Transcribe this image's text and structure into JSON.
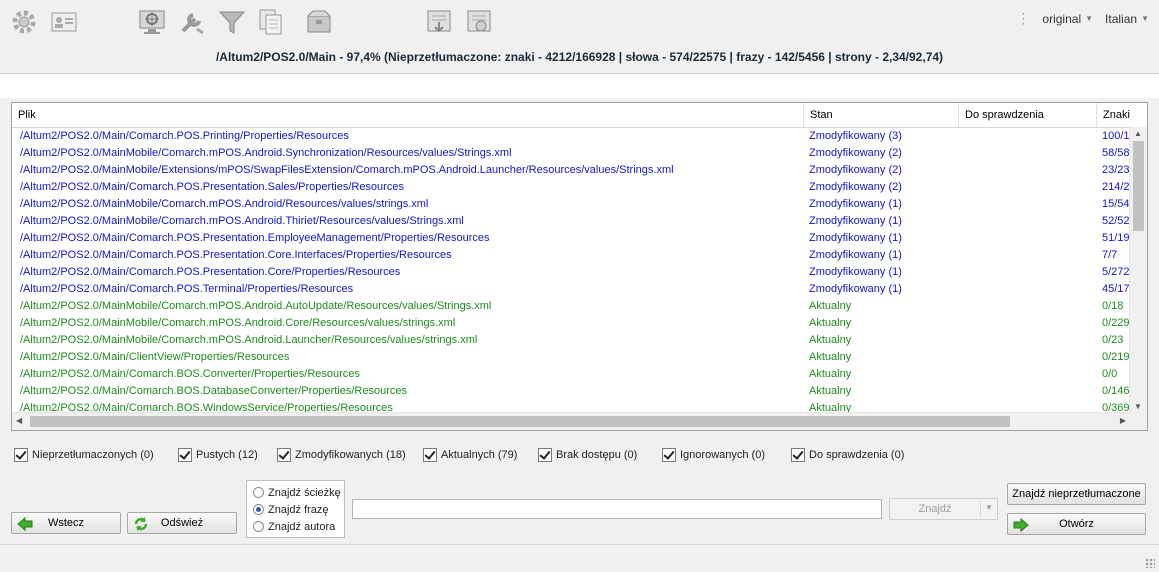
{
  "toolbar": {
    "icons": [
      "gear-icon",
      "id-card-icon",
      "monitor-target-icon",
      "tools-icon",
      "filter-icon",
      "documents-icon",
      "package-icon",
      "download-list-icon",
      "upload-list-icon"
    ],
    "version_select": "original",
    "language_select": "Italian"
  },
  "header": {
    "path_info": "/Altum2/POS2.0/Main - 97,4% (Nieprzetłumaczone: znaki - 4212/166928 | słowa - 574/22575 | frazy - 142/5456 | strony - 2,34/92,74)"
  },
  "table": {
    "columns": [
      "Plik",
      "Stan",
      "Do sprawdzenia",
      "Znaki"
    ],
    "rows": [
      {
        "file": "/Altum2/POS2.0/Main/Comarch.POS.Printing/Properties/Resources",
        "status": "Zmodyfikowany (3)",
        "check": "",
        "chars": "100/1",
        "color": "blue"
      },
      {
        "file": "/Altum2/POS2.0/MainMobile/Comarch.mPOS.Android.Synchronization/Resources/values/Strings.xml",
        "status": "Zmodyfikowany (2)",
        "check": "",
        "chars": "58/58",
        "color": "blue"
      },
      {
        "file": "/Altum2/POS2.0/MainMobile/Extensions/mPOS/SwapFilesExtension/Comarch.mPOS.Android.Launcher/Resources/values/Strings.xml",
        "status": "Zmodyfikowany (2)",
        "check": "",
        "chars": "23/23",
        "color": "blue"
      },
      {
        "file": "/Altum2/POS2.0/Main/Comarch.POS.Presentation.Sales/Properties/Resources",
        "status": "Zmodyfikowany (2)",
        "check": "",
        "chars": "214/2",
        "color": "blue"
      },
      {
        "file": "/Altum2/POS2.0/MainMobile/Comarch.mPOS.Android/Resources/values/strings.xml",
        "status": "Zmodyfikowany (1)",
        "check": "",
        "chars": "15/54",
        "color": "blue"
      },
      {
        "file": "/Altum2/POS2.0/MainMobile/Comarch.mPOS.Android.Thiriet/Resources/values/Strings.xml",
        "status": "Zmodyfikowany (1)",
        "check": "",
        "chars": "52/52",
        "color": "blue"
      },
      {
        "file": "/Altum2/POS2.0/Main/Comarch.POS.Presentation.EmployeeManagement/Properties/Resources",
        "status": "Zmodyfikowany (1)",
        "check": "",
        "chars": "51/19",
        "color": "blue"
      },
      {
        "file": "/Altum2/POS2.0/Main/Comarch.POS.Presentation.Core.Interfaces/Properties/Resources",
        "status": "Zmodyfikowany (1)",
        "check": "",
        "chars": "7/7",
        "color": "blue"
      },
      {
        "file": "/Altum2/POS2.0/Main/Comarch.POS.Presentation.Core/Properties/Resources",
        "status": "Zmodyfikowany (1)",
        "check": "",
        "chars": "5/272",
        "color": "blue"
      },
      {
        "file": "/Altum2/POS2.0/Main/Comarch.POS.Terminal/Properties/Resources",
        "status": "Zmodyfikowany (1)",
        "check": "",
        "chars": "45/17",
        "color": "blue"
      },
      {
        "file": "/Altum2/POS2.0/MainMobile/Comarch.mPOS.Android.AutoUpdate/Resources/values/Strings.xml",
        "status": "Aktualny",
        "check": "",
        "chars": "0/18",
        "color": "green"
      },
      {
        "file": "/Altum2/POS2.0/MainMobile/Comarch.mPOS.Android.Core/Resources/values/strings.xml",
        "status": "Aktualny",
        "check": "",
        "chars": "0/229",
        "color": "green"
      },
      {
        "file": "/Altum2/POS2.0/MainMobile/Comarch.mPOS.Android.Launcher/Resources/values/strings.xml",
        "status": "Aktualny",
        "check": "",
        "chars": "0/23",
        "color": "green"
      },
      {
        "file": "/Altum2/POS2.0/Main/ClientView/Properties/Resources",
        "status": "Aktualny",
        "check": "",
        "chars": "0/219",
        "color": "green"
      },
      {
        "file": "/Altum2/POS2.0/Main/Comarch.BOS.Converter/Properties/Resources",
        "status": "Aktualny",
        "check": "",
        "chars": "0/0",
        "color": "green"
      },
      {
        "file": "/Altum2/POS2.0/Main/Comarch.BOS.DatabaseConverter/Properties/Resources",
        "status": "Aktualny",
        "check": "",
        "chars": "0/146",
        "color": "green"
      },
      {
        "file": "/Altum2/POS2.0/Main/Comarch.BOS.WindowsService/Properties/Resources",
        "status": "Aktualny",
        "check": "",
        "chars": "0/369",
        "color": "green"
      }
    ]
  },
  "filters": [
    {
      "label": "Nieprzetłumaczonych (0)",
      "checked": true
    },
    {
      "label": "Pustych (12)",
      "checked": true
    },
    {
      "label": "Zmodyfikowanych (18)",
      "checked": true
    },
    {
      "label": "Aktualnych (79)",
      "checked": true
    },
    {
      "label": "Brak dostępu (0)",
      "checked": true
    },
    {
      "label": "Ignorowanych (0)",
      "checked": true
    },
    {
      "label": "Do sprawdzenia (0)",
      "checked": true
    }
  ],
  "buttons": {
    "back": "Wstecz",
    "refresh": "Odśwież",
    "find": "Znajdź",
    "find_untranslated": "Znajdź nieprzetłumaczone",
    "open": "Otwórz"
  },
  "search_modes": [
    {
      "label": "Znajdź ścieżkę",
      "selected": false
    },
    {
      "label": "Znajdź frazę",
      "selected": true
    },
    {
      "label": "Znajdź autora",
      "selected": false
    }
  ],
  "search_input": {
    "value": "",
    "placeholder": ""
  },
  "colors": {
    "modified": "#1515c8",
    "current": "#1e8c1e",
    "accent": "#2a5fb8"
  }
}
